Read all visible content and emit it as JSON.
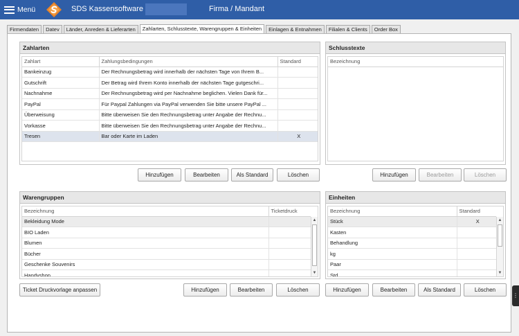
{
  "titlebar": {
    "menu_label": "Menü",
    "app_title": "SDS Kassensoftware",
    "company": "Firma / Mandant",
    "logo_icon": "sds-logo-icon",
    "menu_icon": "hamburger-icon",
    "accent": "#2f5ea7"
  },
  "tabs": [
    {
      "label": "Firmendaten"
    },
    {
      "label": "Datev"
    },
    {
      "label": "Länder, Anreden & Lieferarten"
    },
    {
      "label": "Zahlarten, Schlusstexte, Warengruppen & Einheiten",
      "active": true
    },
    {
      "label": "Einlagen & Entnahmen"
    },
    {
      "label": "Filialen & Clients"
    },
    {
      "label": "Order Box"
    }
  ],
  "zahlarten": {
    "title": "Zahlarten",
    "columns": [
      "Zahlart",
      "Zahlungsbedingungen",
      "Standard"
    ],
    "rows": [
      {
        "name": "Bankeinzug",
        "terms": "Der Rechnungsbetrag wird innerhalb der nächsten Tage von Ihrem B...",
        "standard": ""
      },
      {
        "name": "Gutschrift",
        "terms": "Der Betrag wird Ihrem Konto innerhalb der nächsten Tage gutgeschri...",
        "standard": ""
      },
      {
        "name": "Nachnahme",
        "terms": "Der Rechnungsbetrag wird per Nachnahme beglichen. Vielen Dank für...",
        "standard": ""
      },
      {
        "name": "PayPal",
        "terms": "Für Paypal Zahlungen via PayPal verwenden Sie bitte unsere PayPal ...",
        "standard": ""
      },
      {
        "name": "Überweisung",
        "terms": "Bitte überweisen Sie den Rechnungsbetrag unter Angabe der Rechnu...",
        "standard": ""
      },
      {
        "name": "Vorkasse",
        "terms": "Bitte überweisen Sie den Rechnungsbetrag unter Angabe der Rechnu...",
        "standard": ""
      },
      {
        "name": "Tresen",
        "terms": "Bar oder Karte im Laden",
        "standard": "X"
      }
    ],
    "buttons": {
      "add": "Hinzufügen",
      "edit": "Bearbeiten",
      "default": "Als Standard",
      "delete": "Löschen"
    }
  },
  "schlusstexte": {
    "title": "Schlusstexte",
    "columns": [
      "Bezeichnung"
    ],
    "buttons": {
      "add": "Hinzufügen",
      "edit": "Bearbeiten",
      "delete": "Löschen"
    }
  },
  "warengruppen": {
    "title": "Warengruppen",
    "columns": [
      "Bezeichnung",
      "Ticketdruck"
    ],
    "rows": [
      {
        "name": "Bekleidung Mode",
        "ticket": ""
      },
      {
        "name": "BIO Laden",
        "ticket": ""
      },
      {
        "name": "Blumen",
        "ticket": ""
      },
      {
        "name": "Bücher",
        "ticket": ""
      },
      {
        "name": "Geschenke Souvenirs",
        "ticket": ""
      },
      {
        "name": "Handyshop",
        "ticket": ""
      }
    ],
    "buttons": {
      "ticket": "Ticket Druckvorlage anpassen",
      "add": "Hinzufügen",
      "edit": "Bearbeiten",
      "delete": "Löschen"
    }
  },
  "einheiten": {
    "title": "Einheiten",
    "columns": [
      "Bezeichnung",
      "Standard"
    ],
    "rows": [
      {
        "name": "Stück",
        "standard": "X"
      },
      {
        "name": "Kasten",
        "standard": ""
      },
      {
        "name": "Behandlung",
        "standard": ""
      },
      {
        "name": "kg",
        "standard": ""
      },
      {
        "name": "Paar",
        "standard": ""
      },
      {
        "name": "Std",
        "standard": ""
      }
    ],
    "buttons": {
      "add": "Hinzufügen",
      "edit": "Bearbeiten",
      "default": "Als Standard",
      "delete": "Löschen"
    }
  },
  "icons": {
    "scroll_up": "scroll-up-arrow-icon",
    "scroll_down": "scroll-down-arrow-icon"
  }
}
